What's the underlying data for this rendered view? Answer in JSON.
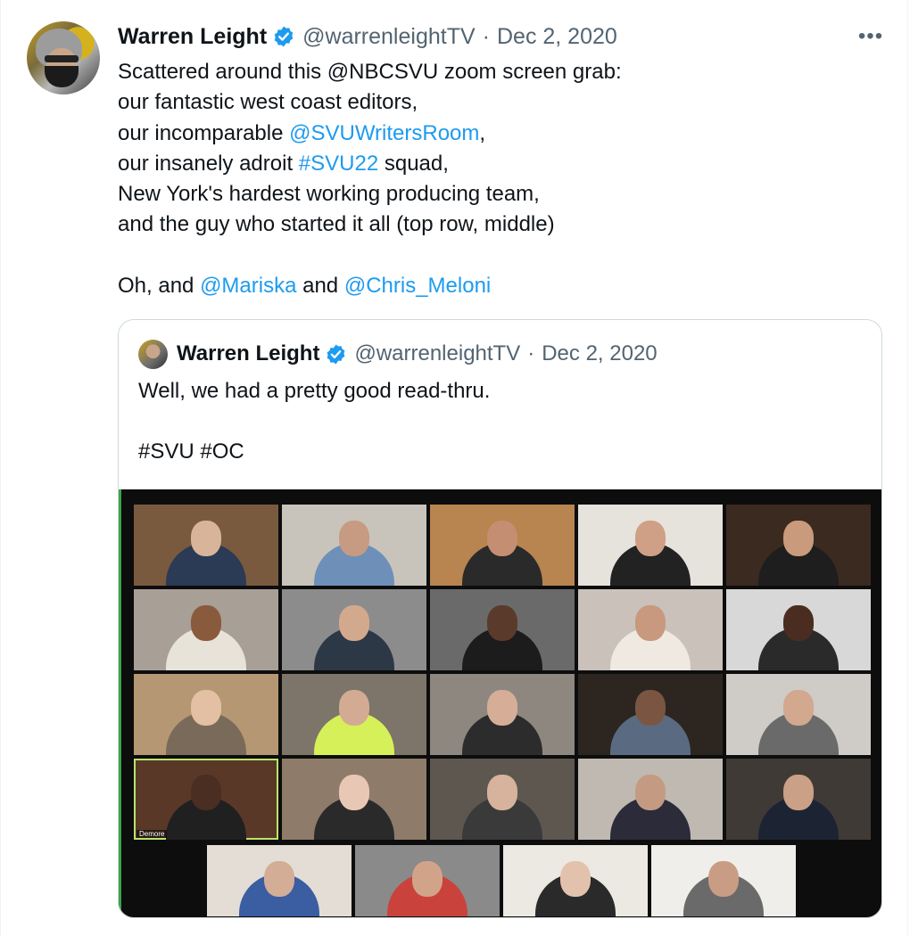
{
  "tweet": {
    "author_name": "Warren Leight",
    "handle": "@warrenleightTV",
    "separator": "·",
    "date": "Dec 2, 2020",
    "more": "•••",
    "lines": [
      [
        {
          "t": "Scattered around this @NBCSVU zoom screen grab:",
          "link": false
        }
      ],
      [
        {
          "t": "our fantastic west coast editors,",
          "link": false
        }
      ],
      [
        {
          "t": "our incomparable ",
          "link": false
        },
        {
          "t": "@SVUWritersRoom",
          "link": true
        },
        {
          "t": ",",
          "link": false
        }
      ],
      [
        {
          "t": "our insanely adroit ",
          "link": false
        },
        {
          "t": "#SVU22",
          "link": true
        },
        {
          "t": " squad,",
          "link": false
        }
      ],
      [
        {
          "t": "New York's hardest working producing team,",
          "link": false
        }
      ],
      [
        {
          "t": "and the guy who started it all (top row, middle)",
          "link": false
        }
      ],
      [
        {
          "t": "",
          "link": false
        }
      ],
      [
        {
          "t": "Oh, and ",
          "link": false
        },
        {
          "t": "@Mariska",
          "link": true
        },
        {
          "t": " and ",
          "link": false
        },
        {
          "t": "@Chris_Meloni",
          "link": true
        }
      ]
    ]
  },
  "quoted": {
    "author_name": "Warren Leight",
    "handle": "@warrenleightTV",
    "separator": "·",
    "date": "Dec 2, 2020",
    "lines": [
      "Well, we had a pretty good read-thru.",
      "",
      "#SVU #OC"
    ],
    "media": {
      "active_caption": "Demore",
      "tiles": [
        {
          "bg": "#7a5a3e",
          "skin": "#d8b49a",
          "shirt": "#2b3a55"
        },
        {
          "bg": "#c8c4bb",
          "skin": "#c79b82",
          "shirt": "#6e90b8"
        },
        {
          "bg": "#b8844f",
          "skin": "#c48e72",
          "shirt": "#2a2a2a"
        },
        {
          "bg": "#e6e2dc",
          "skin": "#cfa085",
          "shirt": "#222222"
        },
        {
          "bg": "#3b2a20",
          "skin": "#c99a7c",
          "shirt": "#1e1e1e"
        },
        {
          "bg": "#a89f96",
          "skin": "#8a5a3c",
          "shirt": "#e8e3d8"
        },
        {
          "bg": "#8c8c8c",
          "skin": "#d3a98e",
          "shirt": "#2c3846"
        },
        {
          "bg": "#6a6a6a",
          "skin": "#5a3b2b",
          "shirt": "#1c1c1c"
        },
        {
          "bg": "#c9c1ba",
          "skin": "#c8997e",
          "shirt": "#efe9e2"
        },
        {
          "bg": "#d8d8d8",
          "skin": "#4a2d20",
          "shirt": "#2a2a2a"
        },
        {
          "bg": "#b59873",
          "skin": "#e3c0a3",
          "shirt": "#7a6a5a"
        },
        {
          "bg": "#7d746a",
          "skin": "#d3ab92",
          "shirt": "#d6f05a"
        },
        {
          "bg": "#8d8780",
          "skin": "#d6ae98",
          "shirt": "#2c2c2c"
        },
        {
          "bg": "#2c2520",
          "skin": "#7a5642",
          "shirt": "#5a6a80"
        },
        {
          "bg": "#cfcbc6",
          "skin": "#d2a88e",
          "shirt": "#6a6a6a"
        },
        {
          "bg": "#5a3828",
          "skin": "#4a2e22",
          "shirt": "#202020"
        },
        {
          "bg": "#8f7b6a",
          "skin": "#e8c8b4",
          "shirt": "#2a2a2a"
        },
        {
          "bg": "#5d5750",
          "skin": "#d7b29c",
          "shirt": "#3a3a3a"
        },
        {
          "bg": "#bfb9b2",
          "skin": "#c49b82",
          "shirt": "#2b2b3a"
        },
        {
          "bg": "#3f3a36",
          "skin": "#caa087",
          "shirt": "#1c2433"
        },
        {
          "bg": "#e3ddd5",
          "skin": "#d3ad95",
          "shirt": "#3b5da1"
        },
        {
          "bg": "#8a8a8a",
          "skin": "#d1a48a",
          "shirt": "#c9433c"
        },
        {
          "bg": "#ece8e2",
          "skin": "#e3c2ad",
          "shirt": "#2a2a2a"
        },
        {
          "bg": "#f0eeea",
          "skin": "#c99d84",
          "shirt": "#6a6a6a"
        }
      ]
    }
  },
  "colors": {
    "link": "#1d9bf0",
    "verified": "#1d9bf0",
    "secondary_text": "#536471",
    "active_border": "#b9e36b"
  }
}
